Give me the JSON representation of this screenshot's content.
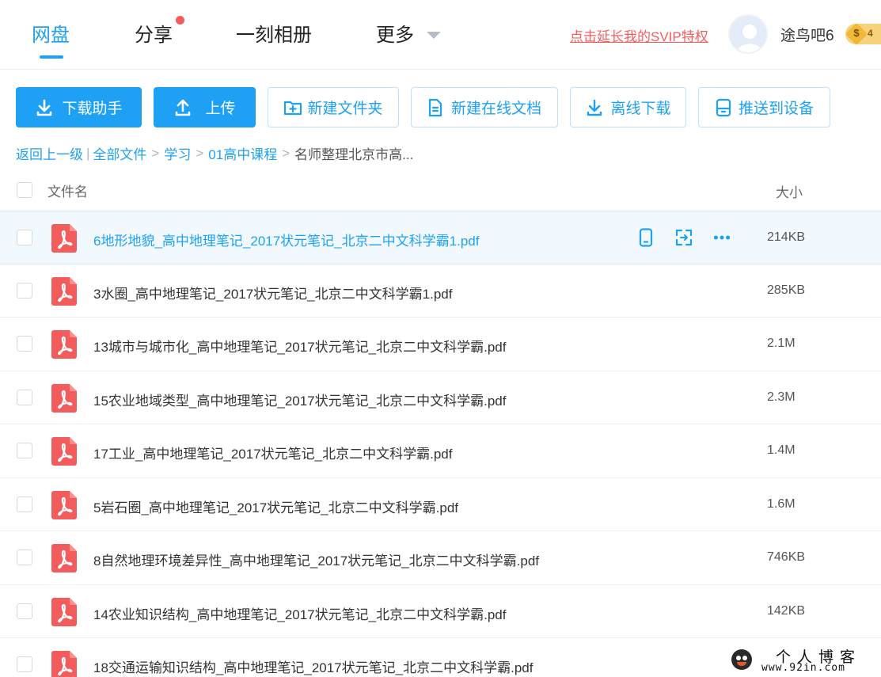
{
  "nav": {
    "tabs": [
      {
        "label": "网盘",
        "active": true
      },
      {
        "label": "分享",
        "has_dot": true
      },
      {
        "label": "一刻相册"
      },
      {
        "label": "更多"
      }
    ],
    "svip_link": "点击延长我的SVIP特权",
    "username": "途鸟吧6",
    "vip_badge": {
      "symbol": "$",
      "level": "4"
    }
  },
  "toolbar": {
    "download_helper": "下载助手",
    "upload": "上传",
    "new_folder": "新建文件夹",
    "new_online_doc": "新建在线文档",
    "offline_download": "离线下载",
    "push_to_device": "推送到设备"
  },
  "breadcrumb": {
    "back": "返回上一级",
    "divider": "|",
    "items": [
      "全部文件",
      "学习",
      "01高中课程"
    ],
    "current": "名师整理北京市高..."
  },
  "list_header": {
    "name": "文件名",
    "size": "大小"
  },
  "files": [
    {
      "name": "6地形地貌_高中地理笔记_2017状元笔记_北京二中文科学霸1.pdf",
      "size": "214KB",
      "highlighted": true
    },
    {
      "name": "3水圈_高中地理笔记_2017状元笔记_北京二中文科学霸1.pdf",
      "size": "285KB"
    },
    {
      "name": "13城市与城市化_高中地理笔记_2017状元笔记_北京二中文科学霸.pdf",
      "size": "2.1M"
    },
    {
      "name": "15农业地域类型_高中地理笔记_2017状元笔记_北京二中文科学霸.pdf",
      "size": "2.3M"
    },
    {
      "name": "17工业_高中地理笔记_2017状元笔记_北京二中文科学霸.pdf",
      "size": "1.4M"
    },
    {
      "name": "5岩石圈_高中地理笔记_2017状元笔记_北京二中文科学霸.pdf",
      "size": "1.6M"
    },
    {
      "name": "8自然地理环境差异性_高中地理笔记_2017状元笔记_北京二中文科学霸.pdf",
      "size": "746KB"
    },
    {
      "name": "14农业知识结构_高中地理笔记_2017状元笔记_北京二中文科学霸.pdf",
      "size": "142KB"
    },
    {
      "name": "18交通运输知识结构_高中地理笔记_2017状元笔记_北京二中文科学霸.pdf",
      "size": ""
    }
  ],
  "watermark": {
    "title": "个人博客",
    "url": "www.92in.com"
  },
  "colors": {
    "accent": "#1ea1f4",
    "svip_red": "#f45d5d",
    "pdf_red": "#f25c5c",
    "row_highlight": "#f2f9fe"
  }
}
